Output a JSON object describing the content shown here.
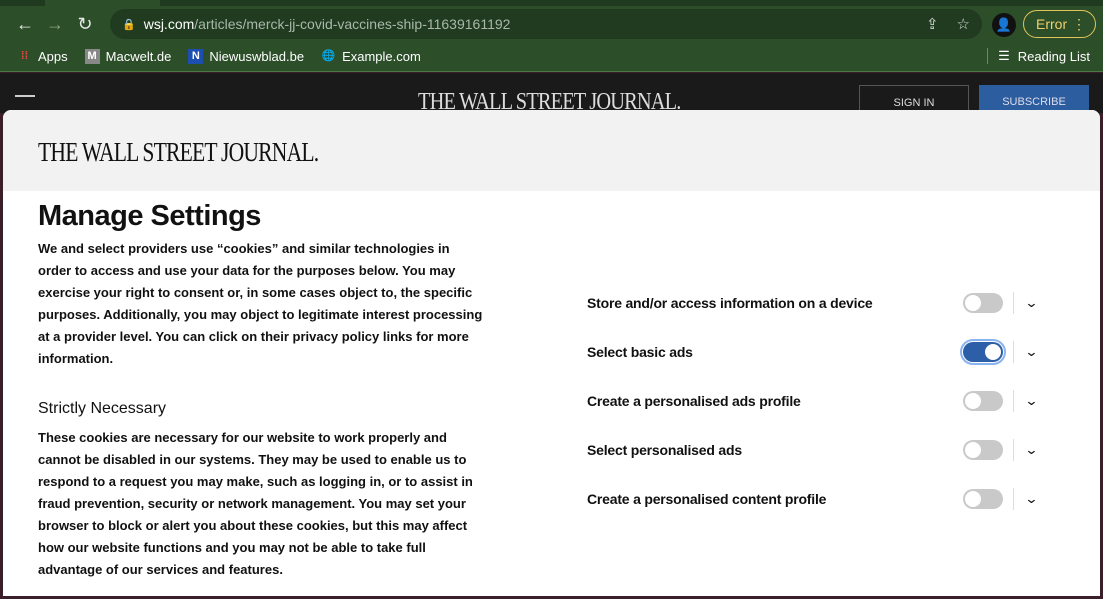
{
  "browser": {
    "url_host": "wsj.com",
    "url_path": "/articles/merck-jj-covid-vaccines-ship-11639161192",
    "error_label": "Error",
    "bookmarks": [
      {
        "label": "Apps",
        "icon": "apps-grid-icon"
      },
      {
        "label": "Macwelt.de",
        "icon": "M"
      },
      {
        "label": "Niewuswblad.be",
        "icon": "N"
      },
      {
        "label": "Example.com",
        "icon": "globe-icon"
      }
    ],
    "reading_list": "Reading List"
  },
  "site": {
    "logo": "THE WALL STREET JOURNAL.",
    "sign_in": "SIGN IN",
    "subscribe": "SUBSCRIBE"
  },
  "modal": {
    "logo": "THE WALL STREET JOURNAL.",
    "title": "Manage Settings",
    "intro": "We and select providers use “cookies” and similar technologies in order to access and use your data for the purposes below. You may exercise your right to consent or, in some cases object to, the specific purposes. Additionally, you may object to legitimate interest processing at a provider level. You can click on their privacy policy links for more information.",
    "strict_title": "Strictly Necessary",
    "strict_text": "These cookies are necessary for our website to work properly and cannot be disabled in our systems. They may be used to enable us to respond to a request you may make, such as logging in, or to assist in fraud prevention, security or network management. You may set your browser to block or alert you about these cookies, but this may affect how our website functions and you may not be able to take full advantage of our services and features.",
    "purposes": [
      {
        "label": "Store and/or access information on a device",
        "enabled": false
      },
      {
        "label": "Select basic ads",
        "enabled": true
      },
      {
        "label": "Create a personalised ads profile",
        "enabled": false
      },
      {
        "label": "Select personalised ads",
        "enabled": false
      },
      {
        "label": "Create a personalised content profile",
        "enabled": false
      }
    ]
  },
  "colors": {
    "browser_chrome": "#2c4f2a",
    "toggle_on": "#2d5fa8",
    "subscribe": "#2c5d9e"
  }
}
